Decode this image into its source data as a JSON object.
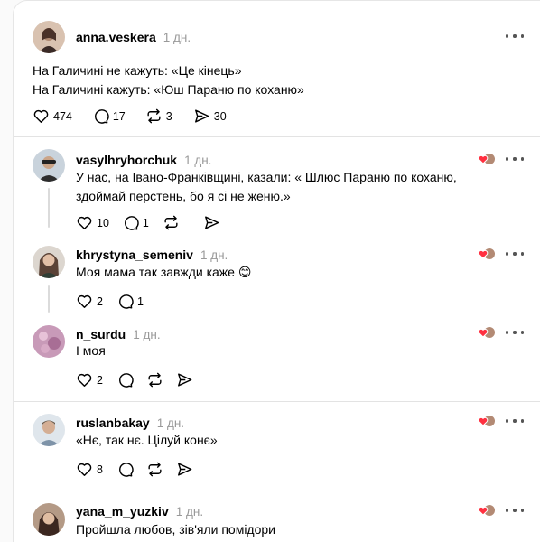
{
  "posts": [
    {
      "username": "anna.veskera",
      "time": "1 дн.",
      "text": "На Галичині не кажуть: «Це кінець»\nНа Галичині кажуть: «Юш Параню по коханю»",
      "likes": "474",
      "replies": "17",
      "reposts": "3",
      "shares": "30",
      "avatar_color": "#8a6a55"
    },
    {
      "username": "vasylhryhorchuk",
      "time": "1 дн.",
      "text": "У нас, на Івано-Франківщині, казали: « Шлюс Параню по коханю, здоймай перстень, бо я сі не женю.»",
      "likes": "10",
      "replies": "1",
      "reposts": "",
      "shares": "",
      "avatar_color": "#6b7a8a"
    },
    {
      "username": "khrystyna_semeniv",
      "time": "1 дн.",
      "text": "Моя мама так завжди каже 😊",
      "likes": "2",
      "replies": "1",
      "reposts": "",
      "shares": "",
      "avatar_color": "#7f6e63"
    },
    {
      "username": "n_surdu",
      "time": "1 дн.",
      "text": "І моя",
      "likes": "2",
      "replies": "",
      "reposts": "",
      "shares": "",
      "avatar_color": "#b07aa5"
    },
    {
      "username": "ruslanbakay",
      "time": "1 дн.",
      "text": "«Нє, так нє. Цілуй конє»",
      "likes": "8",
      "replies": "",
      "reposts": "",
      "shares": "",
      "avatar_color": "#9aa7b3"
    },
    {
      "username": "yana_m_yuzkiv",
      "time": "1 дн.",
      "text": "Пройшла любов, зів'яли помідори",
      "likes": "",
      "replies": "",
      "reposts": "",
      "shares": "",
      "avatar_color": "#6a4a3a"
    }
  ],
  "icons": {
    "like": "heart-icon",
    "reply": "comment-icon",
    "repost": "repost-icon",
    "share": "share-icon",
    "more": "more-options-icon",
    "reaction": "liked-by-author-icon"
  },
  "colors": {
    "reaction_heart": "#ff3040",
    "muted": "#999999"
  }
}
